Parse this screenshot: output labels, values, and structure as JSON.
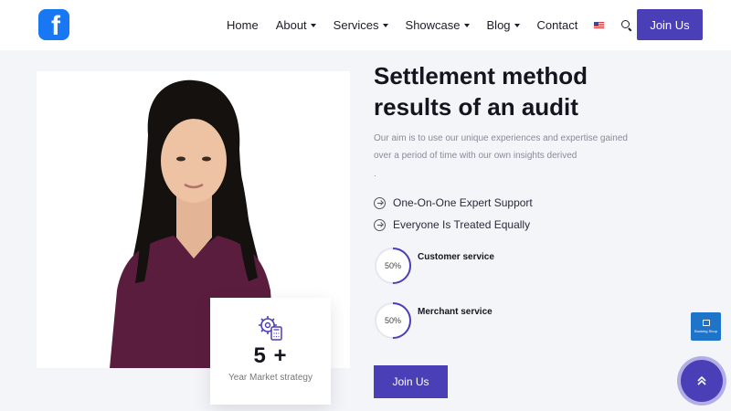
{
  "header": {
    "logo_letter": "f",
    "nav": [
      {
        "label": "Home",
        "dropdown": false
      },
      {
        "label": "About",
        "dropdown": true
      },
      {
        "label": "Services",
        "dropdown": true
      },
      {
        "label": "Showcase",
        "dropdown": true
      },
      {
        "label": "Blog",
        "dropdown": true
      },
      {
        "label": "Contact",
        "dropdown": false
      }
    ],
    "join_label": "Join Us"
  },
  "hero": {
    "title": "Settlement method results of an audit",
    "description": "Our aim is to use our unique experiences and expertise gained over a period of time with our own insights derived",
    "trailing": ".",
    "features": [
      "One-On-One Expert Support",
      "Everyone Is Treated Equally"
    ],
    "progress": [
      {
        "label": "Customer service",
        "value_text": "50%",
        "percent": 50
      },
      {
        "label": "Merchant service",
        "value_text": "50%",
        "percent": 50
      }
    ],
    "cta_label": "Join Us"
  },
  "stat_card": {
    "value": "5 +",
    "label": "Year Market strategy"
  },
  "side_widget": {
    "label": "Booking Shop"
  },
  "colors": {
    "accent": "#4b3fb8",
    "accent_ring": "#b3afe6",
    "brand": "#1877f2",
    "progress_track": "#e6e6ef",
    "photo_shirt": "#5b1d3d",
    "photo_hair": "#14110f"
  },
  "icons": {
    "logo": "facebook-logo",
    "search": "search-icon",
    "feature": "arrow-circle-right-icon",
    "stat": "gear-calculator-icon",
    "scroll_top": "double-chevron-up-icon"
  }
}
